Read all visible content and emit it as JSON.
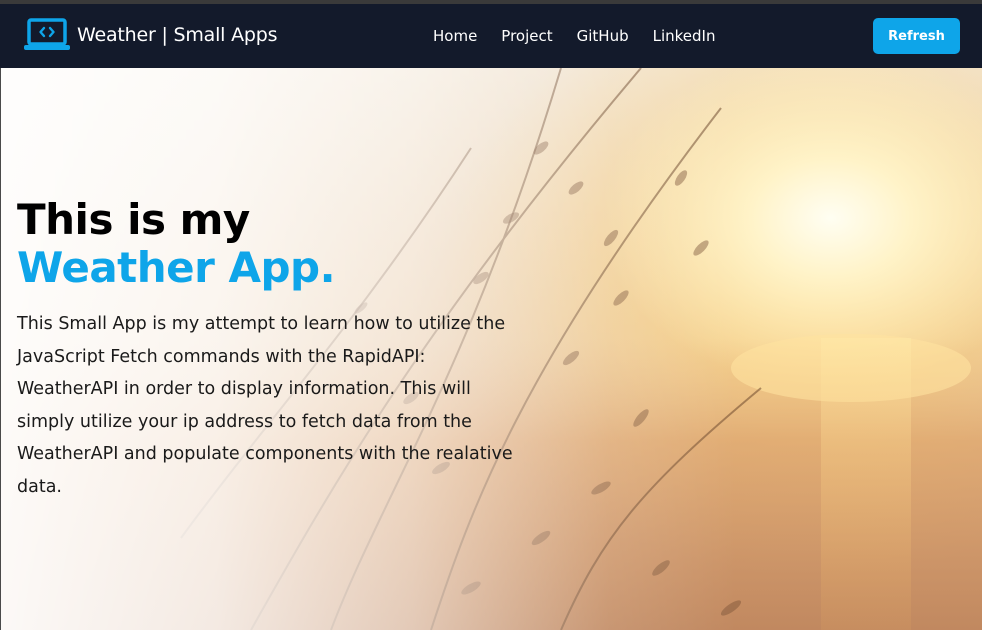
{
  "navbar": {
    "brand_icon": "laptop-code-icon",
    "brand_text": "Weather | Small Apps",
    "links": [
      {
        "label": "Home"
      },
      {
        "label": "Project"
      },
      {
        "label": "GitHub"
      },
      {
        "label": "LinkedIn"
      }
    ],
    "refresh_label": "Refresh"
  },
  "hero": {
    "title_line_1": "This is my",
    "title_line_2": "Weather App.",
    "description": "This Small App is my attempt to learn how to utilize the JavaScript Fetch commands with the RapidAPI: WeatherAPI in order to display information. This will simply utilize your ip address to fetch data from the WeatherAPI and populate components with the realative data."
  },
  "colors": {
    "navbar_bg": "#131a2b",
    "accent": "#0ea5e9",
    "title_text": "#000000",
    "body_text": "#1a1a1a"
  }
}
